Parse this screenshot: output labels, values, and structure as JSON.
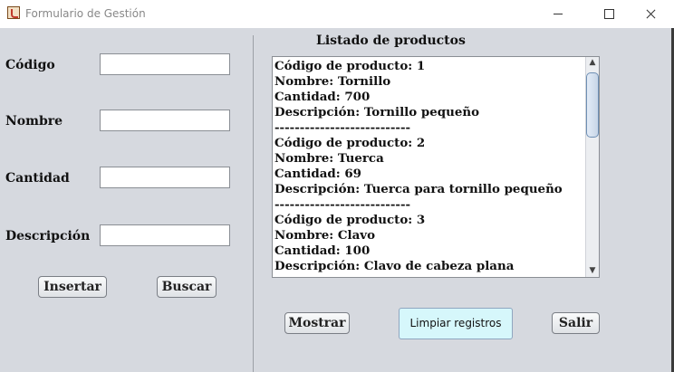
{
  "window": {
    "title": "Formulario de Gestión",
    "icon": "java-cup-icon"
  },
  "form": {
    "codigo_label": "Código",
    "nombre_label": "Nombre",
    "cantidad_label": "Cantidad",
    "descripcion_label": "Descripción",
    "codigo_value": "",
    "nombre_value": "",
    "cantidad_value": "",
    "descripcion_value": ""
  },
  "buttons": {
    "insertar": "Insertar",
    "buscar": "Buscar",
    "mostrar": "Mostrar",
    "limpiar": "Limpiar registros",
    "salir": "Salir"
  },
  "list": {
    "title": "Listado de productos",
    "content": "Código de producto: 1\nNombre: Tornillo\nCantidad: 700\nDescripción: Tornillo pequeño\n---------------------------\nCódigo de producto: 2\nNombre: Tuerca\nCantidad: 69\nDescripción: Tuerca para tornillo pequeño\n---------------------------\nCódigo de producto: 3\nNombre: Clavo\nCantidad: 100\nDescripción: Clavo de cabeza plana"
  },
  "colors": {
    "panel_bg": "#d6d9df",
    "limpiar_bg": "#d6f7fb",
    "thumb": "#c7d5e7"
  }
}
